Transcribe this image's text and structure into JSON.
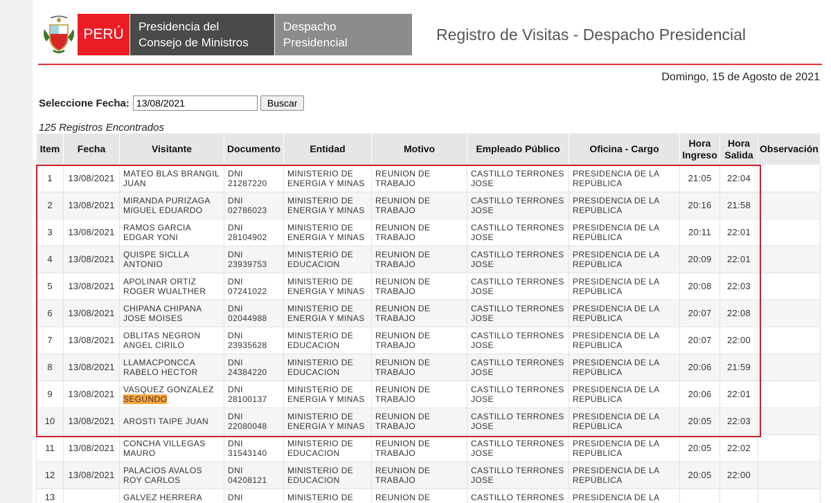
{
  "header": {
    "country": "PERÚ",
    "ministry_line1": "Presidencia del",
    "ministry_line2": "Consejo de Ministros",
    "office_line1": "Despacho",
    "office_line2": "Presidencial",
    "title": "Registro de Visitas - Despacho Presidencial"
  },
  "current_date": "Domingo, 15 de Agosto de 2021",
  "form": {
    "label": "Seleccione Fecha:",
    "date_value": "13/08/2021",
    "search_label": "Buscar"
  },
  "records_count": "125 Registros Encontrados",
  "table": {
    "headers": {
      "item": "Item",
      "fecha": "Fecha",
      "visitante": "Visitante",
      "documento": "Documento",
      "entidad": "Entidad",
      "motivo": "Motivo",
      "empleado": "Empleado Público",
      "oficina": "Oficina - Cargo",
      "hora_ingreso": "Hora Ingreso",
      "hora_salida": "Hora Salida",
      "observacion": "Observación"
    },
    "rows": [
      {
        "item": "1",
        "fecha": "13/08/2021",
        "visitante": "MATEO BLAS BRANGIL JUAN",
        "documento": "DNI 21287220",
        "entidad": "MINISTERIO DE ENERGIA Y MINAS",
        "motivo": "REUNION DE TRABAJO",
        "empleado": "CASTILLO TERRONES JOSE",
        "oficina": "PRESIDENCIA DE LA REPÚBLICA",
        "ingreso": "21:05",
        "salida": "22:04",
        "obs": ""
      },
      {
        "item": "2",
        "fecha": "13/08/2021",
        "visitante": "MIRANDA PURIZAGA MIGUEL EDUARDO",
        "documento": "DNI 02786023",
        "entidad": "MINISTERIO DE ENERGIA Y MINAS",
        "motivo": "REUNION DE TRABAJO",
        "empleado": "CASTILLO TERRONES JOSE",
        "oficina": "PRESIDENCIA DE LA REPÚBLICA",
        "ingreso": "20:16",
        "salida": "21:58",
        "obs": ""
      },
      {
        "item": "3",
        "fecha": "13/08/2021",
        "visitante": "RAMOS GARCIA EDGAR YONI",
        "documento": "DNI 28104902",
        "entidad": "MINISTERIO DE ENERGIA Y MINAS",
        "motivo": "REUNION DE TRABAJO",
        "empleado": "CASTILLO TERRONES JOSE",
        "oficina": "PRESIDENCIA DE LA REPÚBLICA",
        "ingreso": "20:11",
        "salida": "22:01",
        "obs": ""
      },
      {
        "item": "4",
        "fecha": "13/08/2021",
        "visitante": "QUISPE SICLLA ANTONIO",
        "documento": "DNI 23939753",
        "entidad": "MINISTERIO DE EDUCACION",
        "motivo": "REUNION DE TRABAJO",
        "empleado": "CASTILLO TERRONES JOSE",
        "oficina": "PRESIDENCIA DE LA REPÚBLICA",
        "ingreso": "20:09",
        "salida": "22:01",
        "obs": ""
      },
      {
        "item": "5",
        "fecha": "13/08/2021",
        "visitante": "APOLINAR ORTIZ ROGER WUALTHER",
        "documento": "DNI 07241022",
        "entidad": "MINISTERIO DE ENERGIA Y MINAS",
        "motivo": "REUNION DE TRABAJO",
        "empleado": "CASTILLO TERRONES JOSE",
        "oficina": "PRESIDENCIA DE LA REPÚBLICA",
        "ingreso": "20:08",
        "salida": "22:03",
        "obs": ""
      },
      {
        "item": "6",
        "fecha": "13/08/2021",
        "visitante": "CHIPANA CHIPANA JOSE MOISES",
        "documento": "DNI 02044988",
        "entidad": "MINISTERIO DE ENERGIA Y MINAS",
        "motivo": "REUNION DE TRABAJO",
        "empleado": "CASTILLO TERRONES JOSE",
        "oficina": "PRESIDENCIA DE LA REPÚBLICA",
        "ingreso": "20:07",
        "salida": "22:08",
        "obs": ""
      },
      {
        "item": "7",
        "fecha": "13/08/2021",
        "visitante": "OBLITAS NEGRON ANGEL CIRILO",
        "documento": "DNI 23935628",
        "entidad": "MINISTERIO DE EDUCACION",
        "motivo": "REUNION DE TRABAJO",
        "empleado": "CASTILLO TERRONES JOSE",
        "oficina": "PRESIDENCIA DE LA REPÚBLICA",
        "ingreso": "20:07",
        "salida": "22:00",
        "obs": ""
      },
      {
        "item": "8",
        "fecha": "13/08/2021",
        "visitante": "LLAMACPONCCA RABELO HECTOR",
        "documento": "DNI 24384220",
        "entidad": "MINISTERIO DE EDUCACION",
        "motivo": "REUNION DE TRABAJO",
        "empleado": "CASTILLO TERRONES JOSE",
        "oficina": "PRESIDENCIA DE LA REPÚBLICA",
        "ingreso": "20:06",
        "salida": "21:59",
        "obs": ""
      },
      {
        "item": "9",
        "fecha": "13/08/2021",
        "visitante": "VASQUEZ GONZALEZ",
        "visitante_hl": "SEGUNDO",
        "documento": "DNI 28100137",
        "entidad": "MINISTERIO DE ENERGIA Y MINAS",
        "motivo": "REUNION DE TRABAJO",
        "empleado": "CASTILLO TERRONES JOSE",
        "oficina": "PRESIDENCIA DE LA REPÚBLICA",
        "ingreso": "20:06",
        "salida": "22:01",
        "obs": ""
      },
      {
        "item": "10",
        "fecha": "13/08/2021",
        "visitante": "AROSTI TAIPE JUAN",
        "documento": "DNI 22080048",
        "entidad": "MINISTERIO DE ENERGIA Y MINAS",
        "motivo": "REUNION DE TRABAJO",
        "empleado": "CASTILLO TERRONES JOSE",
        "oficina": "PRESIDENCIA DE LA REPÚBLICA",
        "ingreso": "20:05",
        "salida": "22:03",
        "obs": ""
      },
      {
        "item": "11",
        "fecha": "13/08/2021",
        "visitante": "CONCHA VILLEGAS MAURO",
        "documento": "DNI 31543140",
        "entidad": "MINISTERIO DE EDUCACION",
        "motivo": "REUNION DE TRABAJO",
        "empleado": "CASTILLO TERRONES JOSE",
        "oficina": "PRESIDENCIA DE LA REPÚBLICA",
        "ingreso": "20:05",
        "salida": "22:02",
        "obs": ""
      },
      {
        "item": "12",
        "fecha": "13/08/2021",
        "visitante": "PALACIOS AVALOS ROY CARLOS",
        "documento": "DNI 04208121",
        "entidad": "MINISTERIO DE EDUCACION",
        "motivo": "REUNION DE TRABAJO",
        "empleado": "CASTILLO TERRONES JOSE",
        "oficina": "PRESIDENCIA DE LA REPÚBLICA",
        "ingreso": "20:05",
        "salida": "22:00",
        "obs": ""
      },
      {
        "item": "13",
        "fecha": "",
        "visitante": "GALVEZ HERRERA CIRO",
        "documento": "DNI",
        "entidad": "MINISTERIO DE",
        "motivo": "REUNION DE",
        "empleado": "CASTILLO TERRONES",
        "oficina": "PRESIDENCIA DE LA",
        "ingreso": "",
        "salida": "",
        "obs": ""
      }
    ]
  },
  "colors": {
    "brand_red": "#ec1c24",
    "pcm_gray": "#4a4a4a",
    "office_gray": "#8c8c8c",
    "highlight": "#ffa53d",
    "selection_border": "#cc1f2a"
  }
}
